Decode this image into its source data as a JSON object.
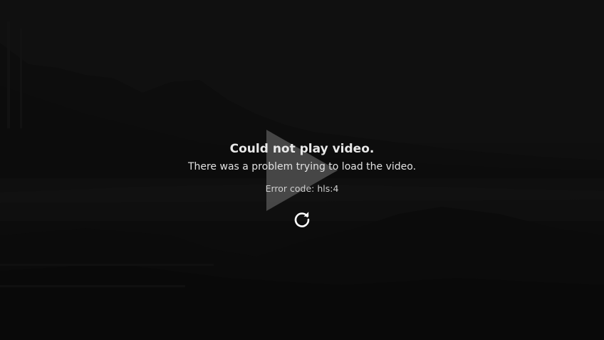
{
  "error": {
    "title": "Could not play video.",
    "message": "There was a problem trying to load the video.",
    "code": "Error code: hls:4"
  },
  "icons": {
    "play": "play-icon",
    "retry": "retry-icon"
  },
  "colors": {
    "background": "#151515",
    "text": "#e8e8e8",
    "play_overlay": "#5a5a5a"
  }
}
